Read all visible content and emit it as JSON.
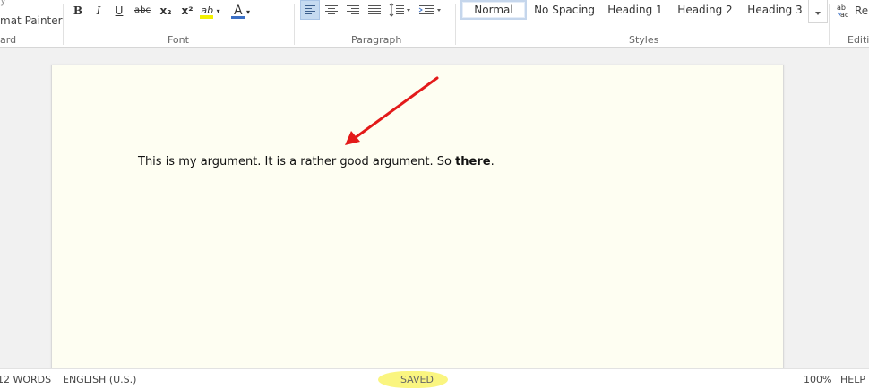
{
  "ribbon": {
    "clipboard": {
      "copy_partial": "y",
      "format_painter_partial": "mat Painter",
      "label_partial": "ard"
    },
    "font": {
      "label": "Font",
      "buttons": [
        "B",
        "I",
        "U",
        "abc",
        "x₂",
        "x²",
        "ab",
        "A"
      ]
    },
    "paragraph": {
      "label": "Paragraph"
    },
    "styles": {
      "label": "Styles",
      "items": [
        "Normal",
        "No Spacing",
        "Heading 1",
        "Heading 2",
        "Heading 3"
      ],
      "selected": "Normal"
    },
    "editing": {
      "replace_partial": "Rep",
      "label_partial": "Editi"
    }
  },
  "document": {
    "text_before_bold": "This is my argument. It is a rather good argument. So ",
    "text_bold": "there",
    "text_after_bold": "."
  },
  "statusbar": {
    "word_count": "12 WORDS",
    "language": "ENGLISH (U.S.)",
    "save_status": "SAVED",
    "zoom": "100%",
    "help_partial": "HELP I"
  },
  "colors": {
    "page_background": "#fefef2",
    "arrow": "#e31a1a",
    "saved_highlight": "#faf580",
    "font_color_bar": "#3b6fc4",
    "highlight_bar": "#f2f000"
  }
}
